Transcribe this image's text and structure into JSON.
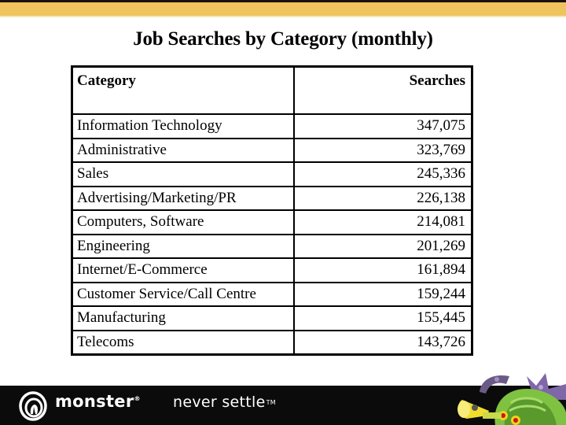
{
  "slide": {
    "title": "Job Searches by Category (monthly)"
  },
  "table": {
    "headers": {
      "category": "Category",
      "searches": "Searches"
    },
    "rows": [
      {
        "category": "Information Technology",
        "searches": "347,075"
      },
      {
        "category": "Administrative",
        "searches": "323,769"
      },
      {
        "category": "Sales",
        "searches": "245,336"
      },
      {
        "category": "Advertising/Marketing/PR",
        "searches": "226,138"
      },
      {
        "category": "Computers, Software",
        "searches": "214,081"
      },
      {
        "category": "Engineering",
        "searches": "201,269"
      },
      {
        "category": "Internet/E-Commerce",
        "searches": "161,894"
      },
      {
        "category": "Customer Service/Call Centre",
        "searches": "159,244"
      },
      {
        "category": "Manufacturing",
        "searches": "155,445"
      },
      {
        "category": "Telecoms",
        "searches": "143,726"
      }
    ]
  },
  "footer": {
    "brand": "monster",
    "brand_mark": "®",
    "tagline": "never settle",
    "tagline_mark": "TM",
    "logo_icon": "monster-swirl-logo-icon",
    "mascot_icon": "green-monster-mascot-icon"
  },
  "colors": {
    "top_band": "#efc45e",
    "top_dark": "#1a120a",
    "footer_bg": "#0b0b0b"
  }
}
